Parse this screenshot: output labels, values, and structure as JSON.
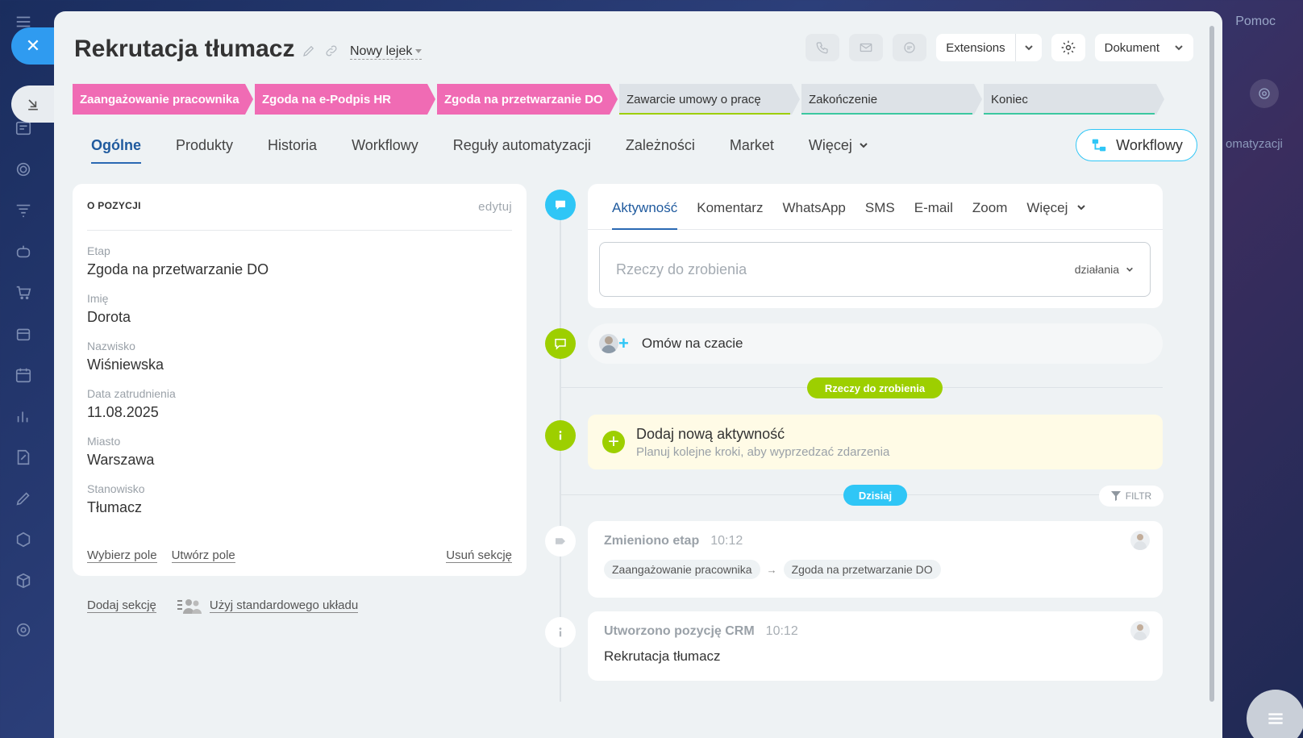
{
  "page": {
    "title": "Rekrutacja tłumacz",
    "funnel": "Nowy lejek",
    "help": "Pomoc",
    "bg_ghost_text": "omatyzacji"
  },
  "toolbar": {
    "extensions": "Extensions",
    "document": "Dokument"
  },
  "stages": [
    {
      "label": "Zaangażowanie pracownika",
      "state": "active"
    },
    {
      "label": "Zgoda na e-Podpis HR",
      "state": "active"
    },
    {
      "label": "Zgoda na przetwarzanie DO",
      "state": "active"
    },
    {
      "label": "Zawarcie umowy o pracę",
      "state": "todo",
      "underline": "#9dcf00"
    },
    {
      "label": "Zakończenie",
      "state": "todo",
      "underline": "#3bc8a0"
    },
    {
      "label": "Koniec",
      "state": "todo",
      "underline": "#3bc8a0"
    }
  ],
  "tabs": [
    {
      "label": "Ogólne"
    },
    {
      "label": "Produkty"
    },
    {
      "label": "Historia"
    },
    {
      "label": "Workflowy"
    },
    {
      "label": "Reguły automatyzacji"
    },
    {
      "label": "Zależności"
    },
    {
      "label": "Market"
    },
    {
      "label": "Więcej"
    }
  ],
  "workflow_button": "Workflowy",
  "details": {
    "header": "O POZYCJI",
    "edit": "edytuj",
    "fields": [
      {
        "label": "Etap",
        "value": "Zgoda na przetwarzanie DO"
      },
      {
        "label": "Imię",
        "value": "Dorota"
      },
      {
        "label": "Nazwisko",
        "value": "Wiśniewska"
      },
      {
        "label": "Data zatrudnienia",
        "value": "11.08.2025"
      },
      {
        "label": "Miasto",
        "value": "Warszawa"
      },
      {
        "label": "Stanowisko",
        "value": "Tłumacz"
      }
    ],
    "choose_field": "Wybierz pole",
    "create_field": "Utwórz pole",
    "remove_section": "Usuń sekcję",
    "add_section": "Dodaj sekcję",
    "default_layout": "Użyj standardowego układu"
  },
  "activity": {
    "tabs": [
      "Aktywność",
      "Komentarz",
      "WhatsApp",
      "SMS",
      "E-mail",
      "Zoom",
      "Więcej"
    ],
    "todo_placeholder": "Rzeczy do zrobienia",
    "actions": "działania",
    "chat": "Omów na czacie",
    "todo_pill": "Rzeczy do zrobienia",
    "new_title": "Dodaj nową aktywność",
    "new_sub": "Planuj kolejne kroki, aby wyprzedzać zdarzenia",
    "today": "Dzisiaj",
    "filter": "FILTR"
  },
  "events": [
    {
      "title": "Zmieniono etap",
      "time": "10:12",
      "from": "Zaangażowanie pracownika",
      "to": "Zgoda na przetwarzanie DO"
    },
    {
      "title": "Utworzono pozycję CRM",
      "time": "10:12",
      "body": "Rekrutacja tłumacz"
    }
  ],
  "colors": {
    "stage_active": "#f06bb4",
    "accent_blue": "#2fc6f6",
    "accent_green": "#9dcf00"
  }
}
